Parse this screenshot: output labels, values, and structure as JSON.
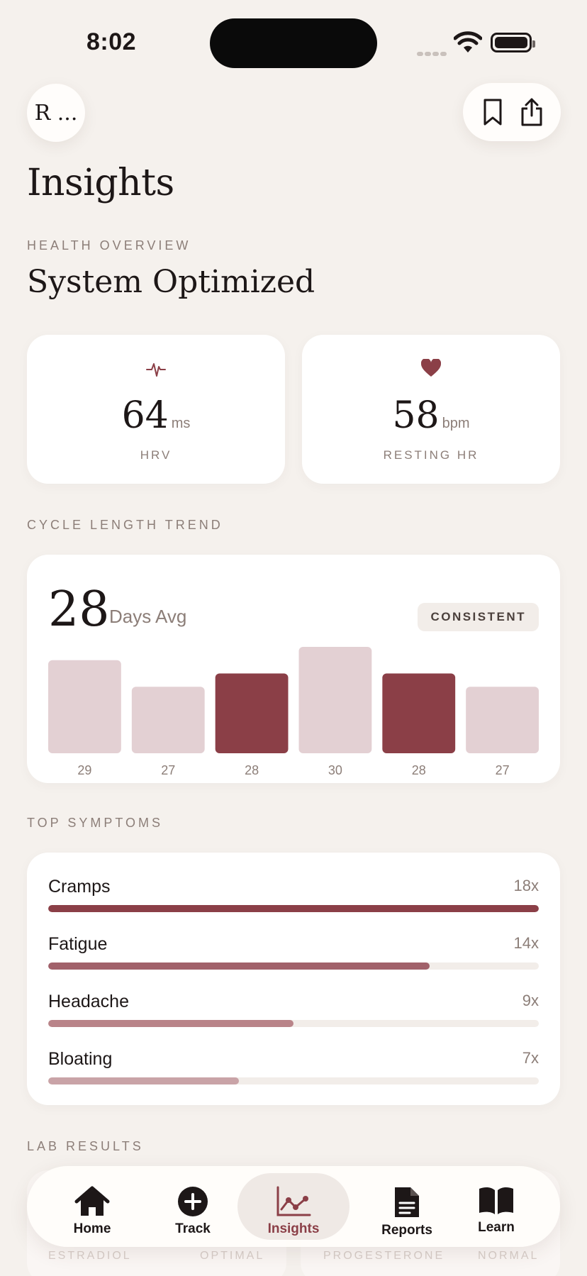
{
  "status": {
    "time": "8:02"
  },
  "header": {
    "avatar_initial": "R ...",
    "title": "Insights"
  },
  "overview": {
    "label": "HEALTH OVERVIEW",
    "title": "System Optimized"
  },
  "metrics": [
    {
      "value": "64",
      "unit": "ms",
      "label": "HRV",
      "icon": "pulse-icon"
    },
    {
      "value": "58",
      "unit": "bpm",
      "label": "RESTING HR",
      "icon": "heart-icon"
    }
  ],
  "cycle": {
    "label": "CYCLE LENGTH TREND",
    "avg_value": "28",
    "avg_label": "Days Avg",
    "badge": "CONSISTENT"
  },
  "chart_data": {
    "type": "bar",
    "categories": [
      "29",
      "27",
      "28",
      "30",
      "28",
      "27"
    ],
    "values": [
      29,
      27,
      28,
      30,
      28,
      27
    ],
    "highlighted": [
      false,
      false,
      true,
      false,
      true,
      false
    ],
    "ylim": [
      22,
      30
    ],
    "colors": {
      "normal": "#e3d0d3",
      "highlight": "#8b3f47"
    }
  },
  "symptoms": {
    "label": "TOP SYMPTOMS",
    "items": [
      {
        "name": "Cramps",
        "count": "18x",
        "fraction": 1.0,
        "color": "#8b3f47"
      },
      {
        "name": "Fatigue",
        "count": "14x",
        "fraction": 0.778,
        "color": "#a1616a"
      },
      {
        "name": "Headache",
        "count": "9x",
        "fraction": 0.5,
        "color": "#b98489"
      },
      {
        "name": "Bloating",
        "count": "7x",
        "fraction": 0.389,
        "color": "#c9a3a7"
      }
    ]
  },
  "labs": {
    "label": "LAB RESULTS",
    "items": [
      {
        "name": "ESTRADIOL",
        "status": "OPTIMAL"
      },
      {
        "name": "PROGESTERONE",
        "status": "NORMAL"
      }
    ]
  },
  "tabs": [
    {
      "label": "Home",
      "icon": "home-icon"
    },
    {
      "label": "Track",
      "icon": "plus-circle-icon"
    },
    {
      "label": "Insights",
      "icon": "chart-icon",
      "active": true
    },
    {
      "label": "Reports",
      "icon": "document-icon"
    },
    {
      "label": "Learn",
      "icon": "book-icon"
    }
  ]
}
